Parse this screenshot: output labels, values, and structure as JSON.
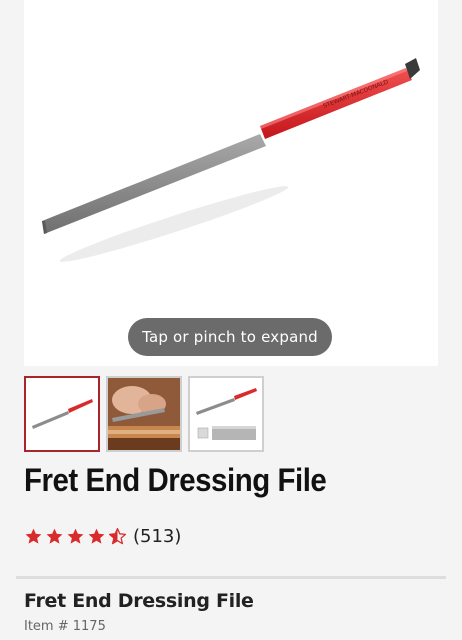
{
  "gallery": {
    "expand_hint": "Tap or pinch to expand",
    "thumbnails": [
      {
        "alt": "file",
        "selected": true
      },
      {
        "alt": "in-use",
        "selected": false
      },
      {
        "alt": "file-and-block",
        "selected": false
      }
    ]
  },
  "product": {
    "title": "Fret End Dressing File",
    "rating": 4.5,
    "review_count": "(513)",
    "variant_name": "Fret End Dressing File",
    "item_number": "Item # 1175"
  },
  "colors": {
    "accent": "#d92b2b",
    "selected_border": "#a8262b"
  }
}
